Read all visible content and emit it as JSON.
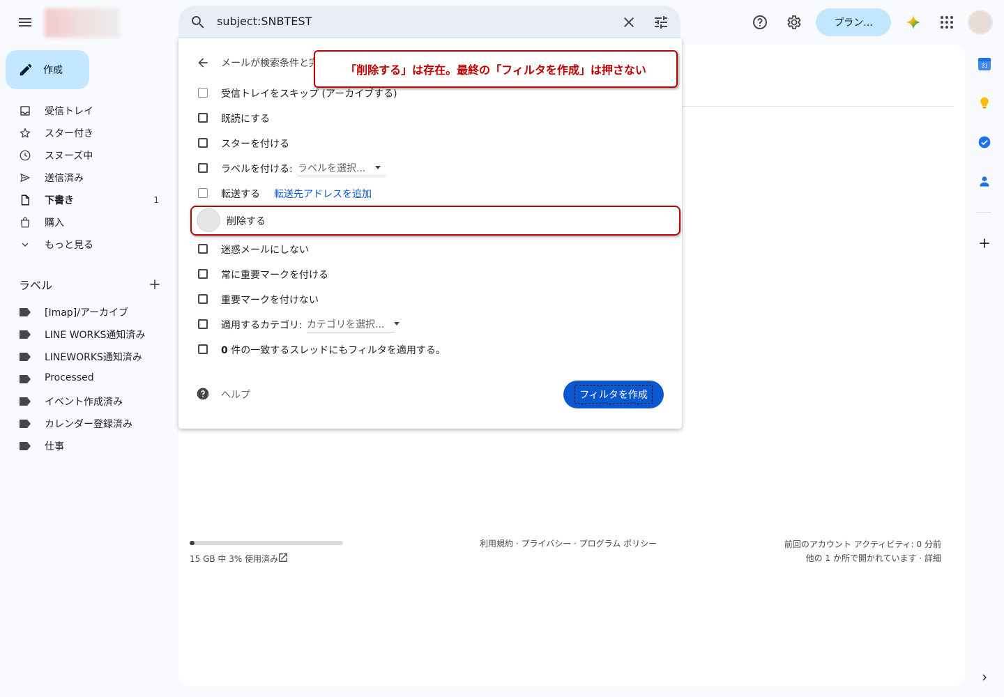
{
  "header": {
    "search_query": "subject:SNBTEST",
    "plan_label": "プラン..."
  },
  "sidebar": {
    "compose_label": "作成",
    "items": [
      {
        "label": "受信トレイ",
        "icon": "inbox-icon"
      },
      {
        "label": "スター付き",
        "icon": "star-icon"
      },
      {
        "label": "スヌーズ中",
        "icon": "clock-icon"
      },
      {
        "label": "送信済み",
        "icon": "send-icon"
      },
      {
        "label": "下書き",
        "icon": "draft-icon",
        "count": "1"
      },
      {
        "label": "購入",
        "icon": "bag-icon"
      },
      {
        "label": "もっと見る",
        "icon": "chevron-down-icon"
      }
    ],
    "labels_heading": "ラベル",
    "labels": [
      "[Imap]/アーカイブ",
      "LINE WORKS通知済み",
      "LINEWORKS通知済み",
      "Processed",
      "イベント作成済み",
      "カレンダー登録済み",
      "仕事"
    ]
  },
  "filter": {
    "title": "メールが検索条件と完",
    "options": {
      "skip_inbox": "受信トレイをスキップ (アーカイブする)",
      "mark_read": "既読にする",
      "star": "スターを付ける",
      "apply_label": "ラベルを付ける:",
      "label_select": "ラベルを選択...",
      "forward": "転送する",
      "forward_link": "転送先アドレスを追加",
      "delete": "削除する",
      "never_spam": "迷惑メールにしない",
      "always_important": "常に重要マークを付ける",
      "never_important": "重要マークを付けない",
      "category": "適用するカテゴリ:",
      "category_select": "カテゴリを選択...",
      "apply_count": "0",
      "apply_existing": "件の一致するスレッドにもフィルタを適用する。"
    },
    "help_label": "ヘルプ",
    "create_label": "フィルタを作成"
  },
  "annotation": {
    "callout_text": "「削除する」は存在。最終の「フィルタを作成」は押さない",
    "color": "#c00000"
  },
  "footer": {
    "storage_text": "15 GB 中 3% 使用済み",
    "storage_percent": 3,
    "links": "利用規約 · プライバシー · プログラム ポリシー",
    "activity_line1": "前回のアカウント アクティビティ: 0 分前",
    "activity_line2": "他の 1 か所で開かれています · 詳細"
  },
  "colors": {
    "accent": "#0b57d0",
    "compose_bg": "#c2e7ff"
  }
}
